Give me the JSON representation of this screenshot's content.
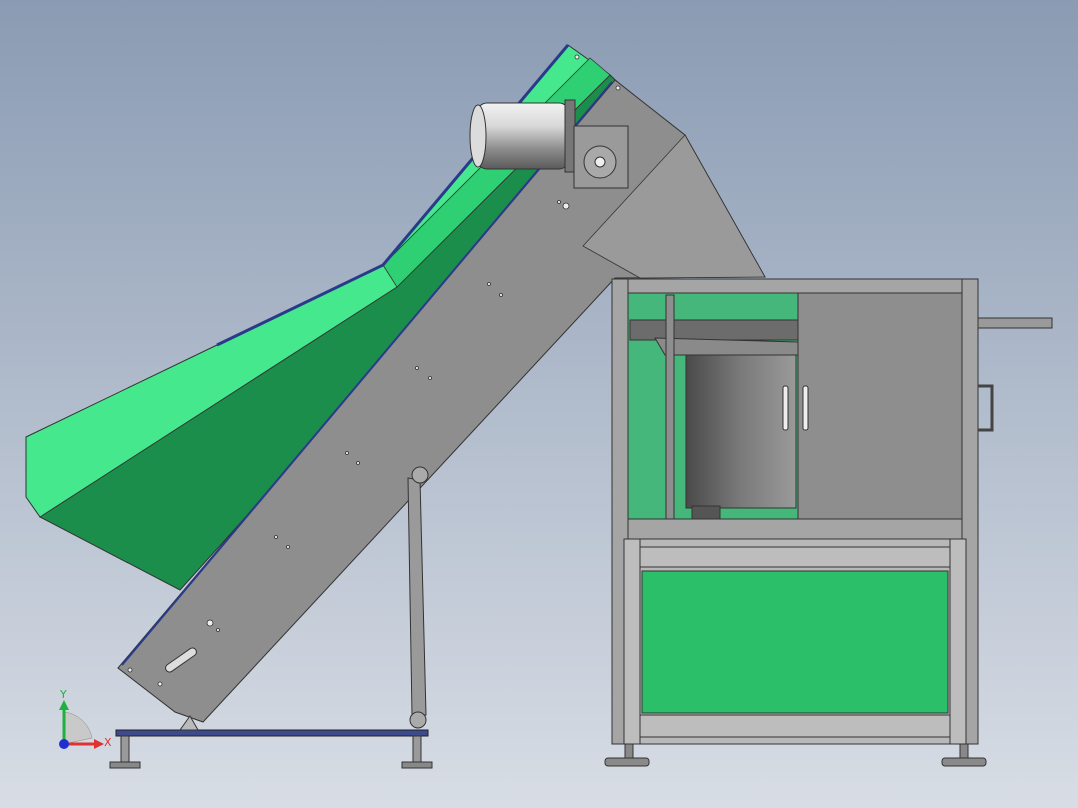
{
  "viewport": {
    "background_top": "#8a9bb3",
    "background_bottom": "#d8dde5"
  },
  "colors": {
    "hopper_green": "#45e88d",
    "hopper_green_dark": "#1c8e4c",
    "panel_green": "#2bbf6a",
    "steel_gray": "#8e8e8e",
    "steel_dark": "#6c6c6c",
    "frame_light": "#b8b8b8",
    "outline": "#333333",
    "motor_silver": "#c8c8c8"
  },
  "triad": {
    "x_label": "X",
    "y_label": "Y",
    "x_color": "#e03030",
    "y_color": "#20b040",
    "z_color": "#2030d0"
  }
}
